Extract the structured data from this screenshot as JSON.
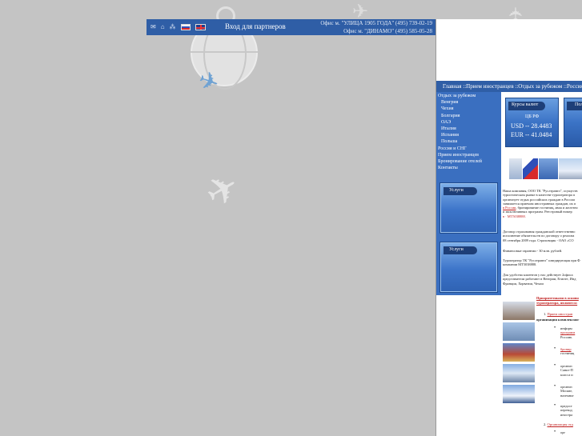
{
  "header": {
    "partner_login": "Вход для партнеров",
    "office_1": "Офис м. \"УЛИЦА 1905 ГОДА\" (495) 739-02-19",
    "office_2": "Офис м. \"ДИНАМО\" (495) 585-05-28",
    "icons": [
      "mail-icon",
      "home-icon",
      "sitemap-icon",
      "flag-ru-icon",
      "flag-uk-icon"
    ]
  },
  "breadcrumb": "Главная ::Прием иностранцев ::Отдых за рубежом ::Россия и СНГ",
  "sidebar": {
    "items": [
      {
        "label": "Отдых за рубежом",
        "level": "top"
      },
      {
        "label": "Венгрия",
        "level": "sub"
      },
      {
        "label": "Чехия",
        "level": "sub"
      },
      {
        "label": "Болгария",
        "level": "sub"
      },
      {
        "label": "ОАЭ",
        "level": "sub"
      },
      {
        "label": "Италия",
        "level": "sub"
      },
      {
        "label": "Испания",
        "level": "sub"
      },
      {
        "label": "Польша",
        "level": "sub"
      },
      {
        "label": "Россия и СНГ",
        "level": "top"
      },
      {
        "label": "Прием иностранцев",
        "level": "top"
      },
      {
        "label": "Бронирование отелей",
        "level": "top"
      },
      {
        "label": "Контакты",
        "level": "top"
      }
    ],
    "services_1": "Услуги",
    "services_2": "Услуги"
  },
  "rates": {
    "title": "Курсы валют",
    "source": "ЦБ РФ",
    "usd": "USD -- 28.4483",
    "eur": "EUR -- 41.0484",
    "second_title": "Пол"
  },
  "content": {
    "p1_lines": [
      "Наша компания, ООО ТК \"Руслтравел\", осуществ",
      "туристическом рынке в качестве туроператора п",
      "организует отдых российских граждан в России",
      "занимается приемом иностранных граждан, их п"
    ],
    "p1_link": "в России",
    "p1_rest": ", бронирование гостиниц, авиа и железно",
    "p1_lines2": "и эксклюзивных программ. Реестровый номер",
    "p1_link2": "в · МТ5038888.",
    "p2_lines": [
      "Договор страхования гражданской ответственно",
      "исполнение обязательств по договору о реализа",
      "08 сентября 2009 года. Страховщик - ОАО «СО"
    ],
    "p3": "Финансовые гарантии - 30 млн. рублей.",
    "p4_lines": [
      "Туроператор ТК \"Руслтравел\" шведирующая при Ф",
      "компании МТ5038888."
    ],
    "p5_lines": [
      "Для удобства клиентов у нас действует 2офиса",
      "представители работают в Венгрии, Египте, Инд",
      "Франции, Хорватии, Чехии"
    ],
    "red_heading_1": "Приоритетными в основн",
    "red_heading_2": "туроператора, являются:",
    "item1_num": "1.",
    "item1_label": "Прием иностран",
    "org_label": "организация комплексног",
    "bullet1_l1": "информ",
    "bullet1_link": "программ",
    "bullet1_l3": "Россию.",
    "bullet2_link": "бронир",
    "bullet2_l2": "гостиниц",
    "bullet3_lines": [
      "организ",
      "Санкт-П",
      "класса и"
    ],
    "bullet4_lines": [
      "организ",
      "Москве,",
      "наземног"
    ],
    "bullet5_lines": [
      "предост",
      "перевод",
      "иностра"
    ],
    "item2_num": "2.",
    "item2_label": "Организация отд",
    "bullet6": "орг"
  }
}
